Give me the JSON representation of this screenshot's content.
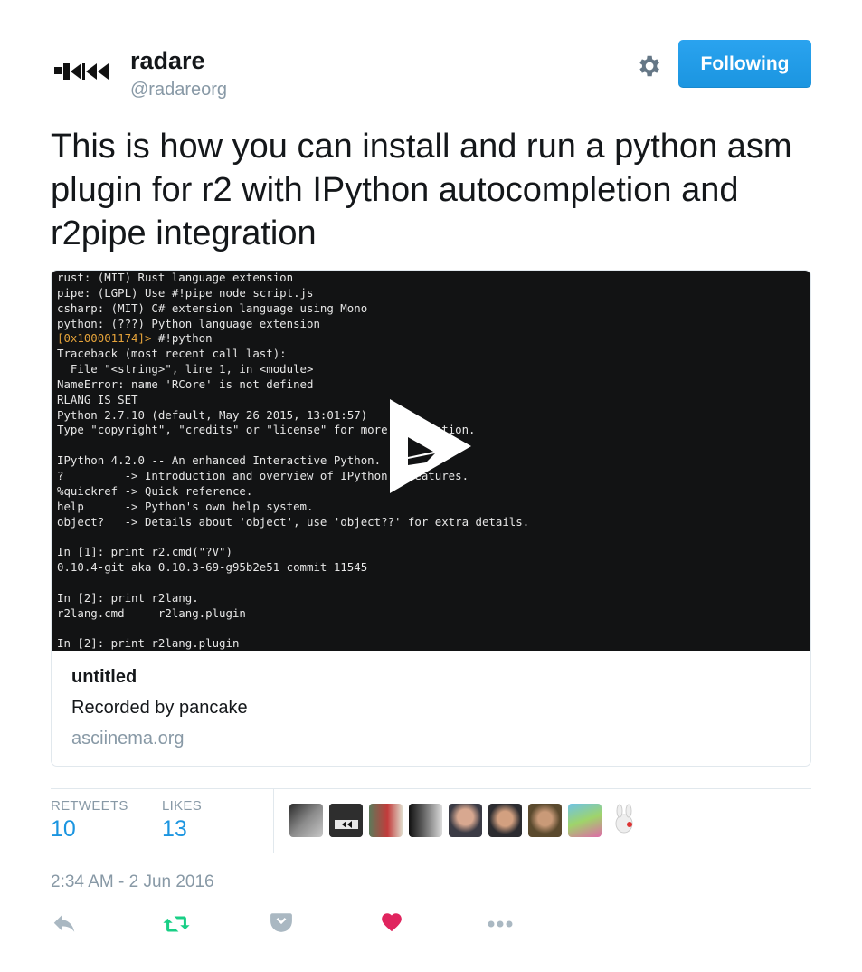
{
  "user": {
    "name": "radare",
    "handle": "@radareorg"
  },
  "follow_button": {
    "label": "Following"
  },
  "tweet": {
    "text": "This is how you can install and run a python asm plugin for r2 with IPython autocompletion and r2pipe integration"
  },
  "card": {
    "terminal_lines": [
      "rust: (MIT) Rust language extension",
      "pipe: (LGPL) Use #!pipe node script.js",
      "csharp: (MIT) C# extension language using Mono",
      "python: (???) Python language extension",
      "#!python",
      "Traceback (most recent call last):",
      "  File \"<string>\", line 1, in <module>",
      "NameError: name 'RCore' is not defined",
      "RLANG IS SET",
      "Python 2.7.10 (default, May 26 2015, 13:01:57)",
      "Type \"copyright\", \"credits\" or \"license\" for more information.",
      "",
      "IPython 4.2.0 -- An enhanced Interactive Python.",
      "?         -> Introduction and overview of IPython's features.",
      "%quickref -> Quick reference.",
      "help      -> Python's own help system.",
      "object?   -> Details about 'object', use 'object??' for extra details.",
      "",
      "In [1]: print r2.cmd(\"?V\")",
      "0.10.4-git aka 0.10.3-69-g95b2e51 commit 11545",
      "",
      "In [2]: print r2lang.",
      "r2lang.cmd     r2lang.plugin",
      "",
      "In [2]: print r2lang.plugin"
    ],
    "terminal_prompt": "[0x100001174]>",
    "title": "untitled",
    "description": "Recorded by pancake",
    "domain": "asciinema.org"
  },
  "stats": {
    "retweets_label": "RETWEETS",
    "retweets_count": "10",
    "likes_label": "LIKES",
    "likes_count": "13"
  },
  "timestamp": "2:34 AM - 2 Jun 2016",
  "colors": {
    "accent": "#1b95e0",
    "retweet": "#19cf86",
    "like": "#e0245e",
    "muted": "#8899a6",
    "terminal_bg": "#121314",
    "prompt": "#e5a33a"
  },
  "icons": {
    "settings": "gear-icon",
    "play": "play-icon",
    "reply": "reply-icon",
    "retweet": "retweet-icon",
    "pocket": "pocket-icon",
    "like": "heart-icon",
    "more": "more-icon"
  }
}
